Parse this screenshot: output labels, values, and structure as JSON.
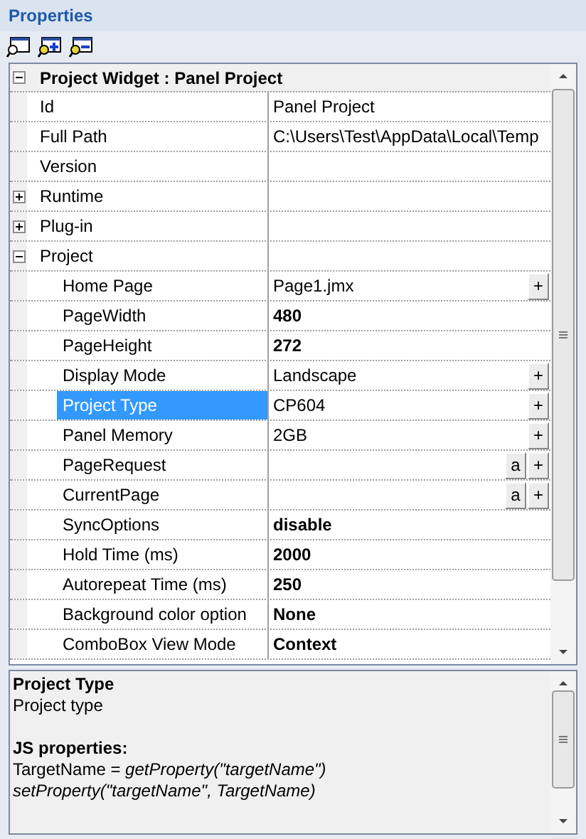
{
  "panel": {
    "title": "Properties"
  },
  "grid": {
    "header": {
      "label": "Project Widget : Panel Project",
      "expanded": true
    },
    "rows": [
      {
        "kind": "property",
        "label": "Id",
        "value": "Panel Project",
        "bold": false,
        "selected": false
      },
      {
        "kind": "property",
        "label": "Full Path",
        "value": "C:\\Users\\Test\\AppData\\Local\\Temp",
        "bold": false,
        "selected": false
      },
      {
        "kind": "property",
        "label": "Version",
        "selected": false
      },
      {
        "kind": "category",
        "label": "Runtime",
        "expanded": false
      },
      {
        "kind": "category",
        "label": "Plug-in",
        "expanded": false
      },
      {
        "kind": "category",
        "label": "Project",
        "expanded": true,
        "children": [
          {
            "kind": "property",
            "label": "Home Page",
            "value": "Page1.jmx",
            "bold": false,
            "selected": false,
            "buttons": [
              "+"
            ]
          },
          {
            "kind": "property",
            "label": "PageWidth",
            "value": "480",
            "bold": true,
            "selected": false
          },
          {
            "kind": "property",
            "label": "PageHeight",
            "value": "272",
            "bold": true,
            "selected": false
          },
          {
            "kind": "property",
            "label": "Display Mode",
            "value": "Landscape",
            "bold": false,
            "selected": false,
            "buttons": [
              "+"
            ]
          },
          {
            "kind": "property",
            "label": "Project Type",
            "value": "CP604",
            "bold": false,
            "selected": true,
            "buttons": [
              "+"
            ]
          },
          {
            "kind": "property",
            "label": "Panel Memory",
            "value": "2GB",
            "bold": false,
            "selected": false,
            "buttons": [
              "+"
            ]
          },
          {
            "kind": "property",
            "label": "PageRequest",
            "selected": false,
            "buttons": [
              "a",
              "+"
            ]
          },
          {
            "kind": "property",
            "label": "CurrentPage",
            "selected": false,
            "buttons": [
              "a",
              "+"
            ]
          },
          {
            "kind": "property",
            "label": "SyncOptions",
            "value": "disable",
            "bold": true,
            "selected": false
          },
          {
            "kind": "property",
            "label": "Hold Time (ms)",
            "value": "2000",
            "bold": true,
            "selected": false
          },
          {
            "kind": "property",
            "label": "Autorepeat Time (ms)",
            "value": "250",
            "bold": true,
            "selected": false
          },
          {
            "kind": "property",
            "label": "Background color option",
            "value": "None",
            "bold": true,
            "selected": false
          },
          {
            "kind": "property",
            "label": "ComboBox View Mode",
            "value": "Context",
            "bold": true,
            "selected": false
          }
        ]
      }
    ]
  },
  "description": {
    "title": "Project Type",
    "text": "Project type",
    "js_heading": "JS properties:",
    "lines": [
      {
        "text": "TargetName = *getProperty(\"targetName\")*",
        "italic": false
      },
      {
        "text": "setProperty(\"targetName\", TargetName)",
        "italic": true
      }
    ]
  }
}
